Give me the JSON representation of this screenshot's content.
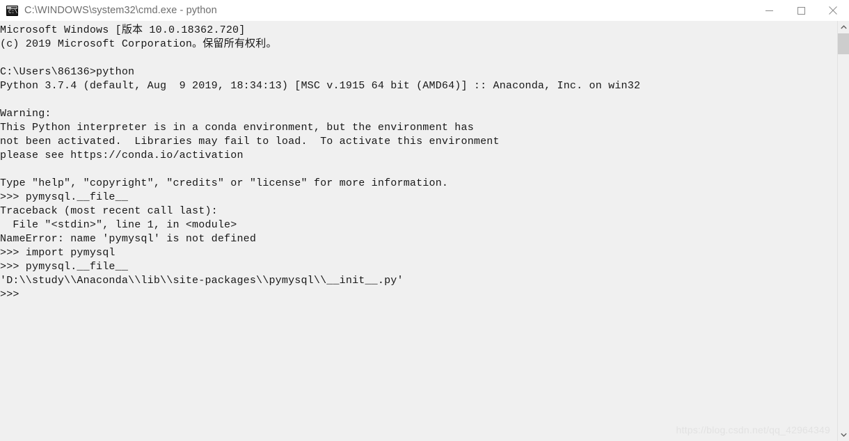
{
  "window": {
    "title": "C:\\WINDOWS\\system32\\cmd.exe - python",
    "icon": "cmd-icon",
    "icon_text": "C:\\",
    "background_color": "#f0f0f0",
    "titlebar_color": "#ffffff",
    "text_color": "#171717"
  },
  "controls": {
    "minimize_label": "Minimize",
    "maximize_label": "Maximize",
    "close_label": "Close"
  },
  "console": {
    "lines": [
      "Microsoft Windows [版本 10.0.18362.720]",
      "(c) 2019 Microsoft Corporation。保留所有权利。",
      "",
      "C:\\Users\\86136>python",
      "Python 3.7.4 (default, Aug  9 2019, 18:34:13) [MSC v.1915 64 bit (AMD64)] :: Anaconda, Inc. on win32",
      "",
      "Warning:",
      "This Python interpreter is in a conda environment, but the environment has",
      "not been activated.  Libraries may fail to load.  To activate this environment",
      "please see https://conda.io/activation",
      "",
      "Type \"help\", \"copyright\", \"credits\" or \"license\" for more information.",
      ">>> pymysql.__file__",
      "Traceback (most recent call last):",
      "  File \"<stdin>\", line 1, in <module>",
      "NameError: name 'pymysql' is not defined",
      ">>> import pymysql",
      ">>> pymysql.__file__",
      "'D:\\\\study\\\\Anaconda\\\\lib\\\\site-packages\\\\pymysql\\\\__init__.py'",
      ">>>"
    ]
  },
  "watermark": {
    "text": "https://blog.csdn.net/qq_42964349",
    "color": "#e2e2e2"
  },
  "scrollbar": {
    "up_arrow": "chevron-up-icon",
    "down_arrow": "chevron-down-icon",
    "thumb_color": "#cdcdcd"
  }
}
